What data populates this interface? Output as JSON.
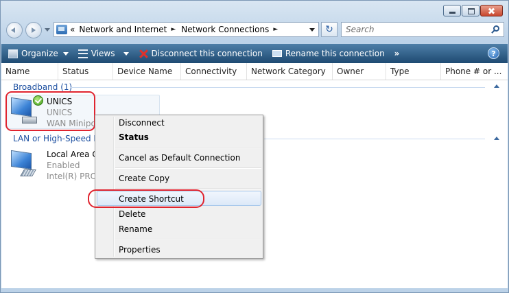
{
  "address": {
    "overflow": "«",
    "crumbs": [
      "Network and Internet",
      "Network Connections"
    ],
    "separator": "►"
  },
  "search": {
    "placeholder": "Search"
  },
  "toolbar": {
    "organize": "Organize",
    "views": "Views",
    "disconnect": "Disconnect this connection",
    "rename": "Rename this connection",
    "more": "»",
    "help": "?"
  },
  "columns": [
    "Name",
    "Status",
    "Device Name",
    "Connectivity",
    "Network Category",
    "Owner",
    "Type",
    "Phone # or ..."
  ],
  "groups": {
    "broadband": "Broadband (1)",
    "lan": "LAN or High-Speed Int"
  },
  "items": [
    {
      "name": "UNICS",
      "status": "UNICS",
      "device": "WAN Minipo"
    },
    {
      "name": "Local Area Co",
      "status": "Enabled",
      "device": "Intel(R) PRO/"
    }
  ],
  "context_menu": {
    "disconnect": "Disconnect",
    "status": "Status",
    "cancel_default": "Cancel as Default Connection",
    "create_copy": "Create Copy",
    "create_shortcut": "Create Shortcut",
    "delete": "Delete",
    "rename": "Rename",
    "properties": "Properties"
  },
  "colors": {
    "toolbar": "#2e5b84",
    "group_text": "#1c4fa0",
    "highlight_ring": "#e0242f"
  }
}
